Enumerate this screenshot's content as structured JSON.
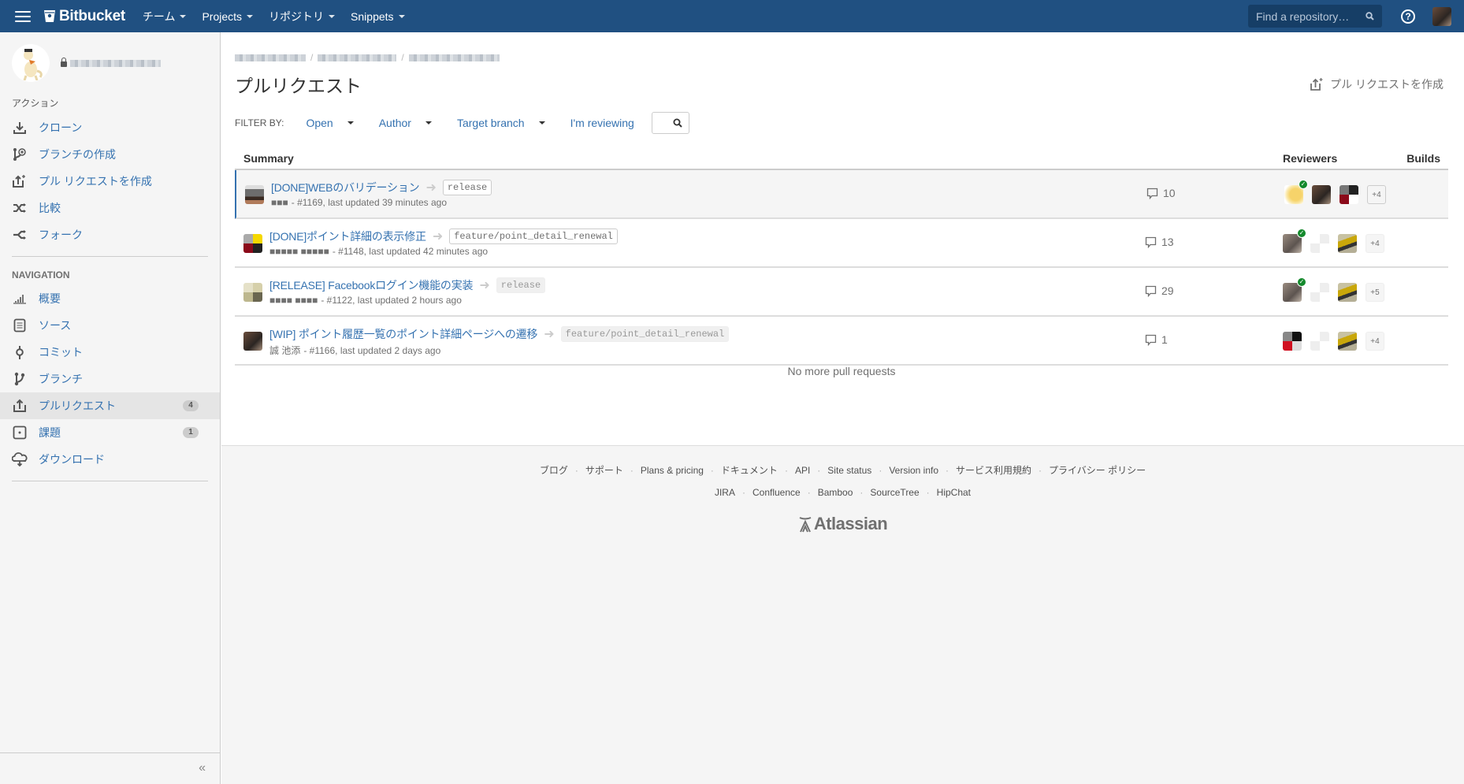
{
  "header": {
    "brand": "Bitbucket",
    "menu": [
      {
        "label": "チーム"
      },
      {
        "label": "Projects"
      },
      {
        "label": "リポジトリ"
      },
      {
        "label": "Snippets"
      }
    ],
    "search_placeholder": "Find a repository…",
    "help_glyph": "?",
    "colors": {
      "bar": "#205081"
    }
  },
  "sidebar": {
    "repo_name_redacted": true,
    "actions_title": "アクション",
    "actions": [
      {
        "label": "クローン",
        "icon": "download-icon"
      },
      {
        "label": "ブランチの作成",
        "icon": "create-branch-icon"
      },
      {
        "label": "プル リクエストを作成",
        "icon": "create-pull-request-icon"
      },
      {
        "label": "比較",
        "icon": "compare-icon"
      },
      {
        "label": "フォーク",
        "icon": "fork-icon"
      }
    ],
    "navigation_title": "NAVIGATION",
    "navigation": [
      {
        "label": "概要",
        "icon": "overview-icon"
      },
      {
        "label": "ソース",
        "icon": "source-icon"
      },
      {
        "label": "コミット",
        "icon": "commit-icon"
      },
      {
        "label": "ブランチ",
        "icon": "branch-icon"
      },
      {
        "label": "プルリクエスト",
        "icon": "pull-request-icon",
        "badge": "4",
        "active": true
      },
      {
        "label": "課題",
        "icon": "issues-icon",
        "badge": "1"
      },
      {
        "label": "ダウンロード",
        "icon": "download-cloud-icon"
      }
    ],
    "collapse_glyph": "«"
  },
  "main": {
    "page_title": "プルリクエスト",
    "create_pr_label": "プル リクエストを作成",
    "filter": {
      "label": "FILTER BY:",
      "status": "Open",
      "author": "Author",
      "target_branch": "Target branch",
      "reviewing": "I'm reviewing"
    },
    "table": {
      "headers": {
        "summary": "Summary",
        "reviewers": "Reviewers",
        "builds": "Builds"
      },
      "rows": [
        {
          "title": "[DONE]WEBのバリデーション",
          "target_branch": "release",
          "author": "■■■",
          "meta": "- #1169, last updated 39 minutes ago",
          "comments": "10",
          "reviewers_more": "+4",
          "approved_first": true
        },
        {
          "title": "[DONE]ポイント詳細の表示修正",
          "target_branch": "feature/point_detail_renewal",
          "author": "■■■■■ ■■■■■",
          "meta": "- #1148, last updated 42 minutes ago",
          "comments": "13",
          "reviewers_more": "+4",
          "approved_first": true
        },
        {
          "title": "[RELEASE] Facebookログイン機能の実装",
          "target_branch": "release",
          "author": "■■■■ ■■■■",
          "meta": "- #1122, last updated 2 hours ago",
          "comments": "29",
          "reviewers_more": "+5",
          "approved_first": true
        },
        {
          "title": "[WIP] ポイント履歴一覧のポイント詳細ページへの遷移",
          "target_branch": "feature/point_detail_renewal",
          "author": "誠 池添",
          "meta": "- #1166, last updated 2 days ago",
          "comments": "1",
          "reviewers_more": "+4",
          "approved_first": false
        }
      ],
      "empty_text": "No more pull requests"
    }
  },
  "footer": {
    "links_row1": [
      "ブログ",
      "サポート",
      "Plans & pricing",
      "ドキュメント",
      "API",
      "Site status",
      "Version info",
      "サービス利用規約",
      "プライバシー ポリシー"
    ],
    "links_row2": [
      "JIRA",
      "Confluence",
      "Bamboo",
      "SourceTree",
      "HipChat"
    ],
    "brand": "Atlassian"
  }
}
